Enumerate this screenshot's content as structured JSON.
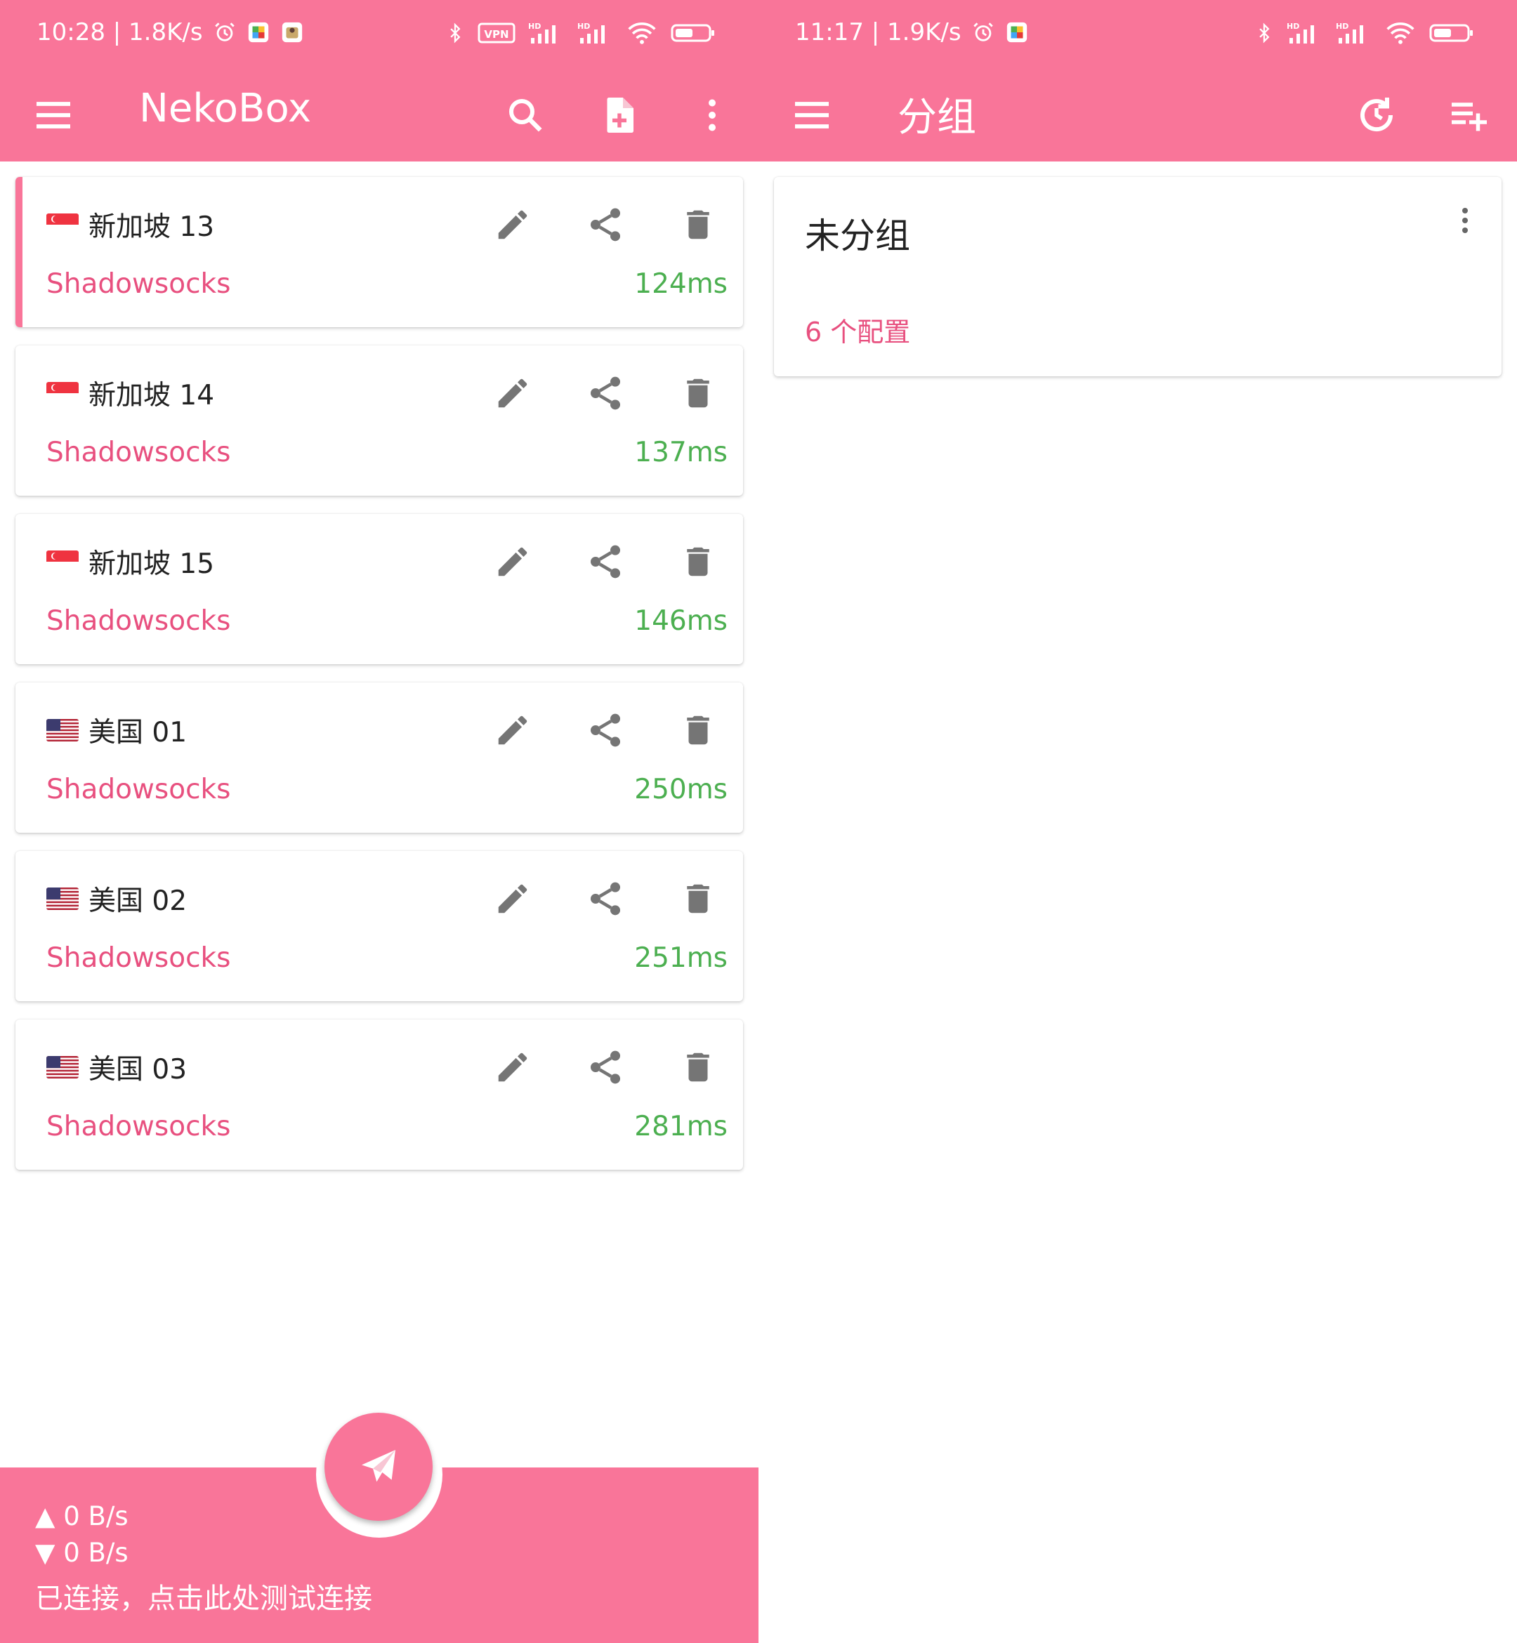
{
  "left": {
    "status": {
      "time_speed": "10:28 | 1.8K/s"
    },
    "appbar": {
      "title": "NekoBox"
    },
    "profiles": [
      {
        "flag": "sg",
        "name": "新加坡 13",
        "protocol": "Shadowsocks",
        "latency": "124ms",
        "selected": true
      },
      {
        "flag": "sg",
        "name": "新加坡 14",
        "protocol": "Shadowsocks",
        "latency": "137ms",
        "selected": false
      },
      {
        "flag": "sg",
        "name": "新加坡 15",
        "protocol": "Shadowsocks",
        "latency": "146ms",
        "selected": false
      },
      {
        "flag": "us",
        "name": "美国 01",
        "protocol": "Shadowsocks",
        "latency": "250ms",
        "selected": false
      },
      {
        "flag": "us",
        "name": "美国 02",
        "protocol": "Shadowsocks",
        "latency": "251ms",
        "selected": false
      },
      {
        "flag": "us",
        "name": "美国 03",
        "protocol": "Shadowsocks",
        "latency": "281ms",
        "selected": false
      }
    ],
    "bottom": {
      "upload": "▲  0 B/s",
      "download": "▼  0 B/s",
      "status": "已连接，点击此处测试连接"
    }
  },
  "right": {
    "status": {
      "time_speed": "11:17 | 1.9K/s"
    },
    "appbar": {
      "title": "分组"
    },
    "groups": [
      {
        "name": "未分组",
        "count": "6 个配置"
      }
    ]
  },
  "colors": {
    "primary": "#f97599",
    "accent": "#e8507f",
    "latency": "#4caf50",
    "icon_gray": "#757575"
  },
  "icons": [
    "menu-icon",
    "search-icon",
    "new-file-icon",
    "more-vert-icon",
    "edit-icon",
    "share-icon",
    "delete-icon",
    "send-icon",
    "history-icon",
    "playlist-add-icon",
    "bluetooth-icon",
    "vpn-icon",
    "signal-icon",
    "wifi-icon",
    "battery-icon",
    "alarm-icon"
  ]
}
